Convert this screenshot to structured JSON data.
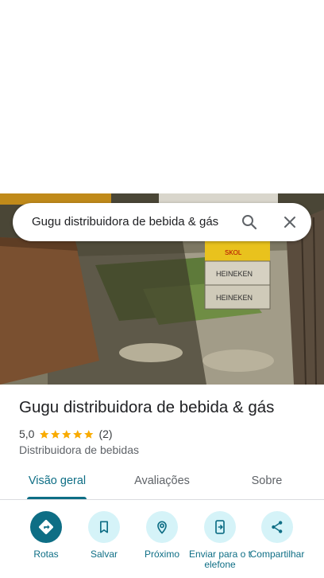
{
  "search": {
    "query": "Gugu distribuidora de bebida & gás",
    "search_icon": "search-icon",
    "close_icon": "close-icon"
  },
  "photo": {
    "subject": "storefront-photo",
    "crate_brand": "HEINEKEN",
    "crate_top_text": "SKOL"
  },
  "place": {
    "name": "Gugu distribuidora de bebida & gás",
    "rating": "5,0",
    "stars": 5,
    "review_count": "(2)",
    "category": "Distribuidora de bebidas"
  },
  "tabs": [
    {
      "label": "Visão geral",
      "active": true
    },
    {
      "label": "Avaliações",
      "active": false
    },
    {
      "label": "Sobre",
      "active": false
    }
  ],
  "actions": [
    {
      "label": "Rotas",
      "icon": "directions-icon"
    },
    {
      "label": "Salvar",
      "icon": "bookmark-icon"
    },
    {
      "label": "Próximo",
      "icon": "nearby-icon"
    },
    {
      "label": "Enviar para o telefone",
      "icon": "send-to-phone-icon"
    },
    {
      "label": "Compartilhar",
      "icon": "share-icon"
    }
  ],
  "colors": {
    "accent": "#0e6e85",
    "accent_light": "#d5f3f8",
    "star": "#f9ab00"
  }
}
